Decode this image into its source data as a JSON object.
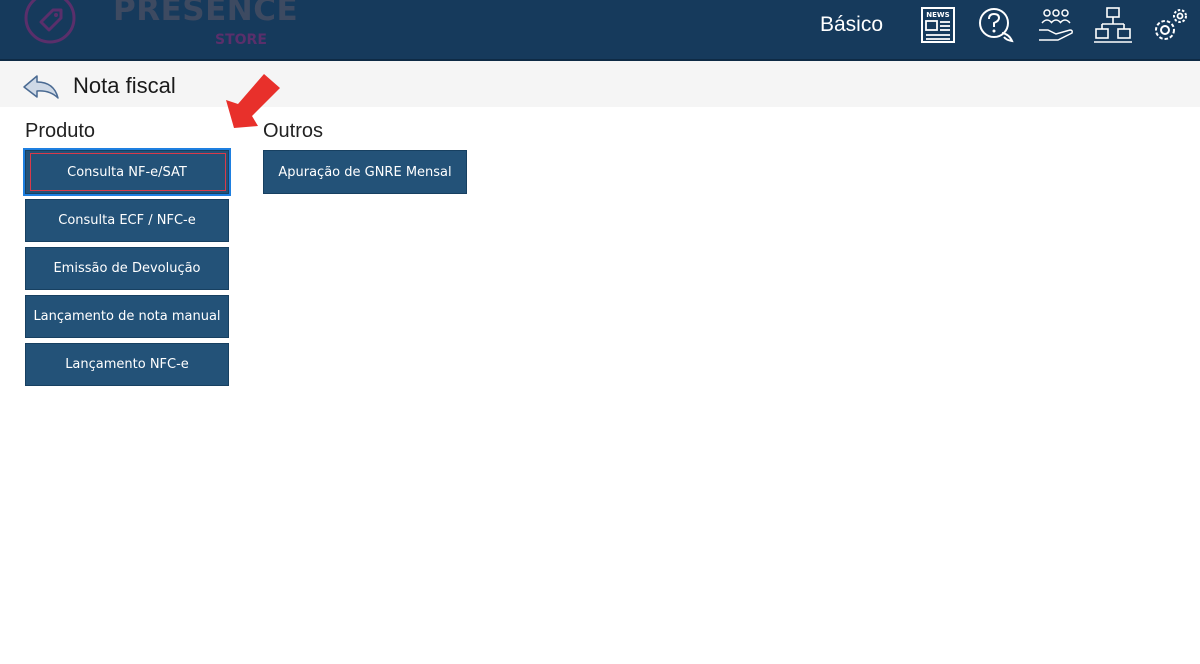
{
  "header": {
    "logo_word": "PRESENCE",
    "logo_sub": "STORE",
    "plan_label": "Básico",
    "news_icon_text": "NEWS",
    "icons": [
      "news-icon",
      "help-icon",
      "people-icon",
      "network-icon",
      "gear-icon"
    ]
  },
  "subheader": {
    "title": "Nota fiscal"
  },
  "sections": {
    "produto": {
      "title": "Produto",
      "buttons": [
        "Consulta NF-e/SAT",
        "Consulta ECF / NFC-e",
        "Emissão de Devolução",
        "Lançamento de nota manual",
        "Lançamento NFC-e"
      ]
    },
    "outros": {
      "title": "Outros",
      "buttons": [
        "Apuração de GNRE Mensal"
      ]
    }
  },
  "colors": {
    "header_bg": "#163a5c",
    "button_bg": "#235278",
    "highlight_arrow": "#e8302b"
  }
}
